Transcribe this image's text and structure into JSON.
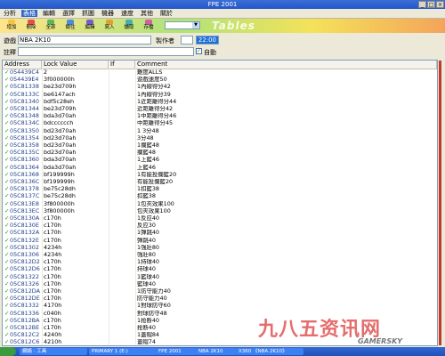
{
  "window": {
    "title": "FPE 2001",
    "minimize": "_",
    "maximize": "□",
    "close": "×"
  },
  "menu": [
    "分析",
    "表格",
    "編輯",
    "選擇",
    "抓圖",
    "機器",
    "速度",
    "其他",
    "關於"
  ],
  "menu_active": 1,
  "toolbar": {
    "buttons": [
      {
        "label": "增加",
        "color": "#f2c53d"
      },
      {
        "label": "刪除",
        "color": "#e05050"
      },
      {
        "label": "全部",
        "color": "#5ab85a"
      },
      {
        "label": "鎖住",
        "color": "#4c8adf"
      },
      {
        "label": "編輯",
        "color": "#7a5ac9"
      },
      {
        "label": "寫入",
        "color": "#e0a030"
      },
      {
        "label": "讀取",
        "color": "#40b0b0"
      },
      {
        "label": "存檔",
        "color": "#d060a0"
      }
    ],
    "combo_value": "",
    "logo": "Tables"
  },
  "form": {
    "game_label": "遊戲",
    "game_value": "NBA 2K10",
    "author_label": "製作者",
    "author_value": "",
    "time_value": "22:00",
    "note_label": "註釋",
    "note_value": "",
    "auto_label": "自動",
    "auto_checked": "✓"
  },
  "table": {
    "headers": [
      "Address",
      "Lock Value",
      "If",
      "Comment"
    ],
    "tick": "✓",
    "rows": [
      {
        "addr": "054439C4",
        "val": "2",
        "cmt": "難度ALLS"
      },
      {
        "addr": "054439E4",
        "val": "3f000000h",
        "cmt": "遊戲速度50"
      },
      {
        "addr": "05C81338",
        "val": "be23d709h",
        "cmt": "1內線得分42"
      },
      {
        "addr": "05C8133C",
        "val": "be6147ach",
        "cmt": "1內線得分39"
      },
      {
        "addr": "05C81340",
        "val": "bdf5c28eh",
        "cmt": "1近距離得分44"
      },
      {
        "addr": "05C81344",
        "val": "be23d709h",
        "cmt": "近距離得分42"
      },
      {
        "addr": "05C81348",
        "val": "bda3d70ah",
        "cmt": "1中距離得分46"
      },
      {
        "addr": "05C8134C",
        "val": "bdcccccch",
        "cmt": "中距離得分45"
      },
      {
        "addr": "05C81350",
        "val": "bd23d70ah",
        "cmt": "1 3分48"
      },
      {
        "addr": "05C81354",
        "val": "bd23d70ah",
        "cmt": "3分48"
      },
      {
        "addr": "05C81358",
        "val": "bd23d70ah",
        "cmt": "1攔籃48"
      },
      {
        "addr": "05C8135C",
        "val": "bd23d70ah",
        "cmt": "攔籃48"
      },
      {
        "addr": "05C81360",
        "val": "bda3d70ah",
        "cmt": "1上籃46"
      },
      {
        "addr": "05C81364",
        "val": "bda3d70ah",
        "cmt": "上籃46"
      },
      {
        "addr": "05C81368",
        "val": "bf199999h",
        "cmt": "1有能投攔籃20"
      },
      {
        "addr": "05C8136C",
        "val": "bf199999h",
        "cmt": "有能投攔籃20"
      },
      {
        "addr": "05C81378",
        "val": "be75c28dh",
        "cmt": "1扣籃38"
      },
      {
        "addr": "05C8137C",
        "val": "be75c28dh",
        "cmt": "扣籃38"
      },
      {
        "addr": "05C813E8",
        "val": "3f800000h",
        "cmt": "1包夾效果100"
      },
      {
        "addr": "05C813EC",
        "val": "3f800000h",
        "cmt": "包夾效果100"
      },
      {
        "addr": "05C8130A",
        "val": "c170h",
        "cmt": "1反应40"
      },
      {
        "addr": "05C8130E",
        "val": "c170h",
        "cmt": "反应30"
      },
      {
        "addr": "05C8132A",
        "val": "c170h",
        "cmt": "1彈跳40"
      },
      {
        "addr": "05C8132E",
        "val": "c170h",
        "cmt": "彈跳40"
      },
      {
        "addr": "05C81302",
        "val": "4234h",
        "cmt": "1強壯80"
      },
      {
        "addr": "05C81306",
        "val": "4234h",
        "cmt": "強壯80"
      },
      {
        "addr": "05C812D2",
        "val": "c170h",
        "cmt": "1持球40"
      },
      {
        "addr": "05C812D6",
        "val": "c170h",
        "cmt": "持球40"
      },
      {
        "addr": "05C81322",
        "val": "c170h",
        "cmt": "1籃球40"
      },
      {
        "addr": "05C81326",
        "val": "c170h",
        "cmt": "籃球40"
      },
      {
        "addr": "05C812DA",
        "val": "c170h",
        "cmt": "1防守能力40"
      },
      {
        "addr": "05C812DE",
        "val": "c170h",
        "cmt": "防守能力40"
      },
      {
        "addr": "05C81332",
        "val": "4170h",
        "cmt": "1對球防守60"
      },
      {
        "addr": "05C81336",
        "val": "c040h",
        "cmt": "對球防守48"
      },
      {
        "addr": "05C812BA",
        "val": "c170h",
        "cmt": "1抢断40"
      },
      {
        "addr": "05C812BE",
        "val": "c170h",
        "cmt": "抢断40"
      },
      {
        "addr": "05C812C2",
        "val": "4240h",
        "cmt": "1蓋帽84"
      },
      {
        "addr": "05C812C6",
        "val": "4210h",
        "cmt": "蓋帽74"
      }
    ]
  },
  "taskbar": [
    "網絡 · 工具",
    "PRIMARY 1 (E:)",
    "FPE 2001",
    "NBA 2K10",
    "X360 《NBA 2K10》"
  ],
  "watermark": "九八五资讯网",
  "watermark_sub": "GAMERSKY"
}
